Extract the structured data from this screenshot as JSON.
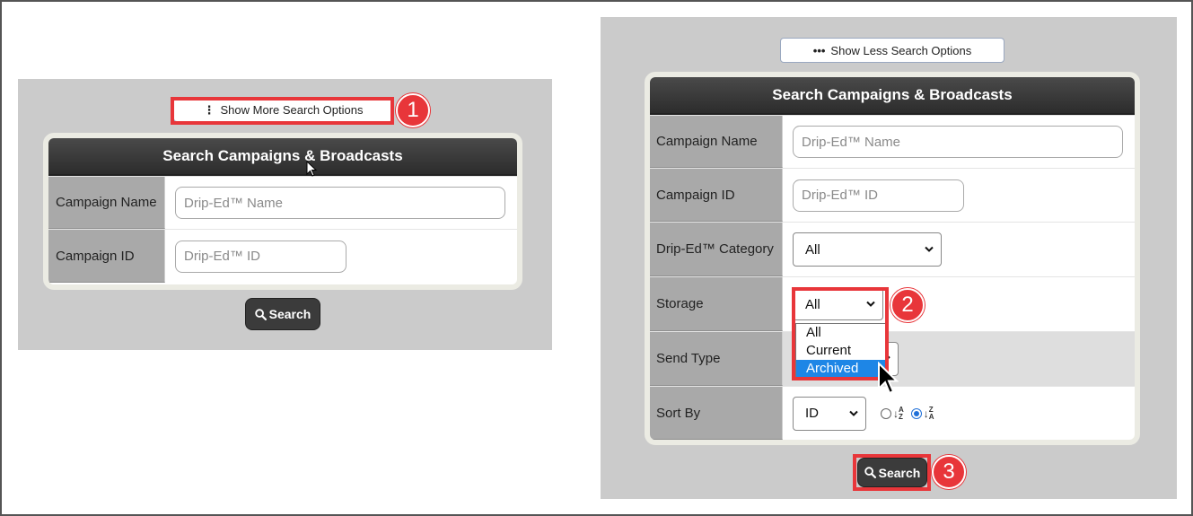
{
  "left": {
    "toggle_label": "Show More Search Options",
    "card_title": "Search Campaigns & Broadcasts",
    "fields": [
      {
        "label": "Campaign Name",
        "placeholder": "Drip-Ed™ Name"
      },
      {
        "label": "Campaign ID",
        "placeholder": "Drip-Ed™ ID"
      }
    ],
    "search_label": "Search",
    "callout": "1"
  },
  "right": {
    "toggle_label": "Show Less Search Options",
    "card_title": "Search Campaigns & Broadcasts",
    "fields": [
      {
        "label": "Campaign Name",
        "placeholder": "Drip-Ed™ Name"
      },
      {
        "label": "Campaign ID",
        "placeholder": "Drip-Ed™ ID"
      },
      {
        "label": "Drip-Ed™ Category",
        "value": "All"
      },
      {
        "label": "Storage",
        "value": "All"
      },
      {
        "label": "Send Type"
      },
      {
        "label": "Sort By",
        "value": "ID"
      }
    ],
    "storage_options": [
      "All",
      "Current",
      "Archived"
    ],
    "storage_selected_option": "Archived",
    "sort_glyph": "↓",
    "sort_asc_letters": [
      "A",
      "Z"
    ],
    "sort_desc_letters": [
      "Z",
      "A"
    ],
    "sort_desc_checked": true,
    "search_label": "Search",
    "callouts": [
      "2",
      "3"
    ]
  },
  "colors": {
    "highlight": "#e8363a",
    "selected_option": "#1e86e6",
    "panel_bg": "#cbcbcb",
    "header_dark": "#3b3b3b"
  }
}
